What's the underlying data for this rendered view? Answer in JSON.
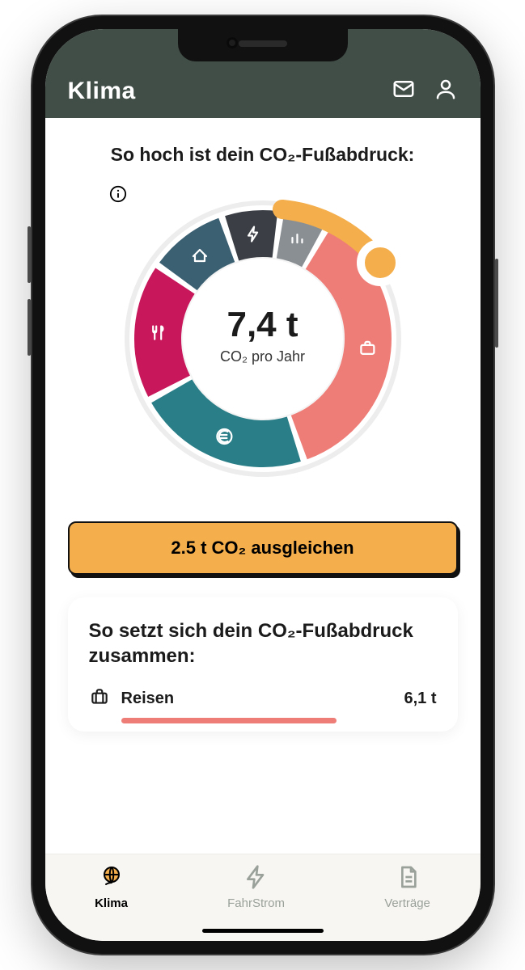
{
  "header": {
    "title": "Klima"
  },
  "main": {
    "headline": "So hoch ist dein CO₂-Fußabdruck:",
    "center_value": "7,4 t",
    "center_sub": "CO₂ pro Jahr",
    "cta_label": "2.5 t CO₂ ausgleichen"
  },
  "chart_data": {
    "type": "pie",
    "title": "CO₂-Fußabdruck",
    "unit": "t CO₂ pro Jahr",
    "total": 7.4,
    "series": [
      {
        "name": "Reisen",
        "icon": "suitcase-icon",
        "value": 2.7,
        "color": "#EE7D78"
      },
      {
        "name": "Finanzen",
        "icon": "euro-icon",
        "value": 1.65,
        "color": "#2A7E87"
      },
      {
        "name": "Ernährung",
        "icon": "fork-icon",
        "value": 1.3,
        "color": "#C8175A"
      },
      {
        "name": "Wohnen",
        "icon": "house-icon",
        "value": 0.75,
        "color": "#3B6072"
      },
      {
        "name": "Strom",
        "icon": "bolt-icon",
        "value": 0.55,
        "color": "#3B3F45"
      },
      {
        "name": "Sonstiges",
        "icon": "bars-icon",
        "value": 0.45,
        "color": "#8A8F94"
      }
    ],
    "offset_value": 2.5,
    "offset_color": "#F4AE4B"
  },
  "breakdown": {
    "title": "So setzt sich dein CO₂-Fußabdruck zusammen:",
    "rows": [
      {
        "icon": "suitcase-icon",
        "label": "Reisen",
        "value": "6,1 t",
        "bar_pct": 62
      }
    ]
  },
  "bottom_nav": {
    "items": [
      {
        "icon": "globe-icon",
        "label": "Klima",
        "active": true
      },
      {
        "icon": "bolt-icon",
        "label": "FahrStrom",
        "active": false
      },
      {
        "icon": "doc-icon",
        "label": "Verträge",
        "active": false
      }
    ]
  }
}
